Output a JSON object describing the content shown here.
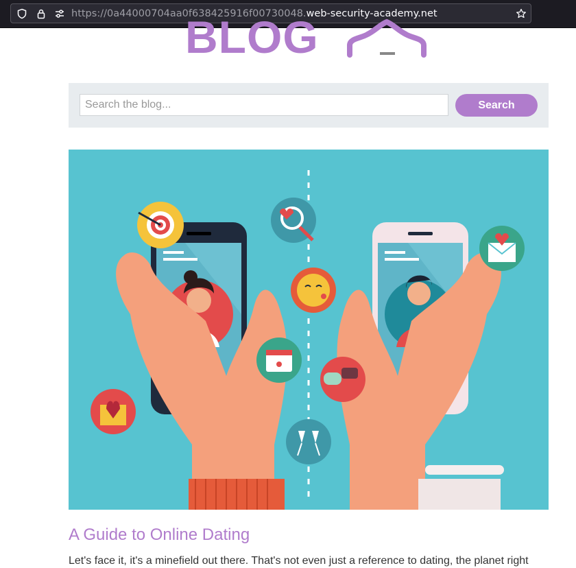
{
  "browser": {
    "url_prefix": "https://0a44000704aa0f638425916f00730048.",
    "url_host": "web-security-academy.net",
    "icons": [
      "shield-icon",
      "lock-icon",
      "site-permissions-icon",
      "bookmark-star-icon"
    ]
  },
  "header": {
    "logo_text": "BLOG",
    "logo_color": "#b07ccc"
  },
  "search": {
    "placeholder": "Search the blog...",
    "value": "",
    "button_label": "Search"
  },
  "post": {
    "image_description_icon": "online-dating-illustration",
    "title": "A Guide to Online Dating",
    "excerpt": "Let's face it, it's a minefield out there. That's not even just a reference to dating, the planet right"
  },
  "colors": {
    "accent": "#b07ccc",
    "panel": "#e8ecef",
    "illustration_bg": "#57c3d0"
  }
}
